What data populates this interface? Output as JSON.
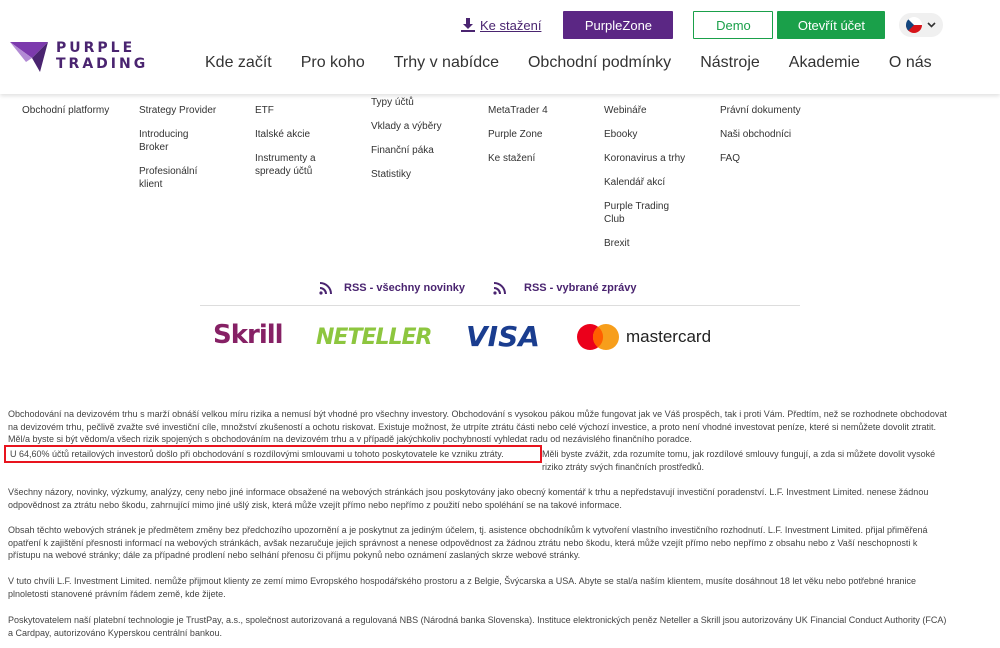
{
  "header": {
    "logo_line1": "PURPLE",
    "logo_line2": "TRADING",
    "download_label": "Ke stažení",
    "purplezone_label": "PurpleZone",
    "demo_label": "Demo",
    "open_account_label": "Otevřít účet",
    "nav": [
      "Kde začít",
      "Pro koho",
      "Trhy v nabídce",
      "Obchodní podmínky",
      "Nástroje",
      "Akademie",
      "O nás"
    ]
  },
  "footer_menu": {
    "col1": [
      "Obchodní platformy"
    ],
    "col2": [
      "Strategy Provider",
      "Introducing Broker",
      "Profesionální klient"
    ],
    "col3": [
      "ETF",
      "Italské akcie",
      "Instrumenty a spready účtů"
    ],
    "col4": [
      "Typy účtů",
      "Vklady a výběry",
      "Finanční páka",
      "Statistiky"
    ],
    "col5": [
      "MetaTrader 4",
      "Purple Zone",
      "Ke stažení"
    ],
    "col6": [
      "Webináře",
      "Ebooky",
      "Koronavirus a trhy",
      "Kalendář akcí",
      "Purple Trading Club",
      "Brexit"
    ],
    "col7": [
      "Právní dokumenty",
      "Naši obchodníci",
      "FAQ"
    ]
  },
  "rss": {
    "all_label": "RSS - všechny novinky",
    "selected_label": "RSS - vybrané zprávy"
  },
  "payments": {
    "skrill": "Skrill",
    "neteller": "NETELLER",
    "visa": "VISA",
    "mastercard": "mastercard"
  },
  "disclaimer": {
    "p1": "Obchodování na devizovém trhu s marží obnáší velkou míru rizika a nemusí být vhodné pro všechny investory. Obchodování s vysokou pákou může fungovat jak ve Váš prospěch, tak i proti Vám. Předtím, než se rozhodnete obchodovat na devizovém trhu, pečlivě zvažte své investiční cíle, množství zkušeností a ochotu riskovat. Existuje možnost, že utrpíte ztrátu části nebo celé výchozí investice, a proto není vhodné investovat peníze, které si nemůžete dovolit ztratit. Měl/a byste si být vědom/a všech rizik spojených s obchodováním na devizovém trhu a v případě jakýchkoliv pochybností vyhledat radu od nezávislého finančního poradce.",
    "highlight": "U 64,60% účtů retailových investorů došlo při obchodování s rozdílovými smlouvami u tohoto poskytovatele ke vzniku ztráty.",
    "p1_tail": "Měli byste zvážit, zda rozumíte tomu, jak rozdílové smlouvy fungují, a zda si můžete dovolit vysoké riziko ztráty svých finančních prostředků.",
    "p2": "Všechny názory, novinky, výzkumy, analýzy, ceny nebo jiné informace obsažené na webových stránkách jsou poskytovány jako obecný komentář k trhu a nepředstavují investiční poradenství. L.F. Investment Limited. nenese žádnou odpovědnost za ztrátu nebo škodu, zahrnující mimo jiné ušlý zisk, která může vzejít přímo nebo nepřímo z použití nebo spoléhání se na takové informace.",
    "p3": "Obsah těchto webových stránek je předmětem změny bez předchozího upozornění a je poskytnut za jediným účelem, tj. asistence obchodníkům k vytvoření vlastního investičního rozhodnutí. L.F. Investment Limited. přijal přiměřená opatření k zajištění přesnosti informací na webových stránkách, avšak nezaručuje jejich správnost a nenese odpovědnost za žádnou ztrátu nebo škodu, která může vzejít přímo nebo nepřímo z obsahu nebo z Vaší neschopnosti k přístupu na webové stránky; dále za případné prodlení nebo selhání přenosu či příjmu pokynů nebo oznámení zaslaných skrze webové stránky.",
    "p4": "V tuto chvíli L.F. Investment Limited. nemůže přijmout klienty ze zemí mimo Evropského hospodářského prostoru a z Belgie, Švýcarska a USA. Abyte se stal/a naším klientem, musíte dosáhnout 18 let věku nebo potřebné hranice plnoletosti stanovené právním řádem země, kde žijete.",
    "p5": "Poskytovatelem naší platební technologie je TrustPay, a.s., společnost autorizovaná a regulovaná NBS (Národná banka Slovenska). Instituce elektronických peněz Neteller a Skrill jsou autorizovány UK Financial Conduct Authority (FCA) a Cardpay, autorizováno Kyperskou centrální bankou."
  },
  "colors": {
    "brand_purple": "#5b2784",
    "green": "#1aa04a",
    "highlight_border": "#e8141e"
  }
}
